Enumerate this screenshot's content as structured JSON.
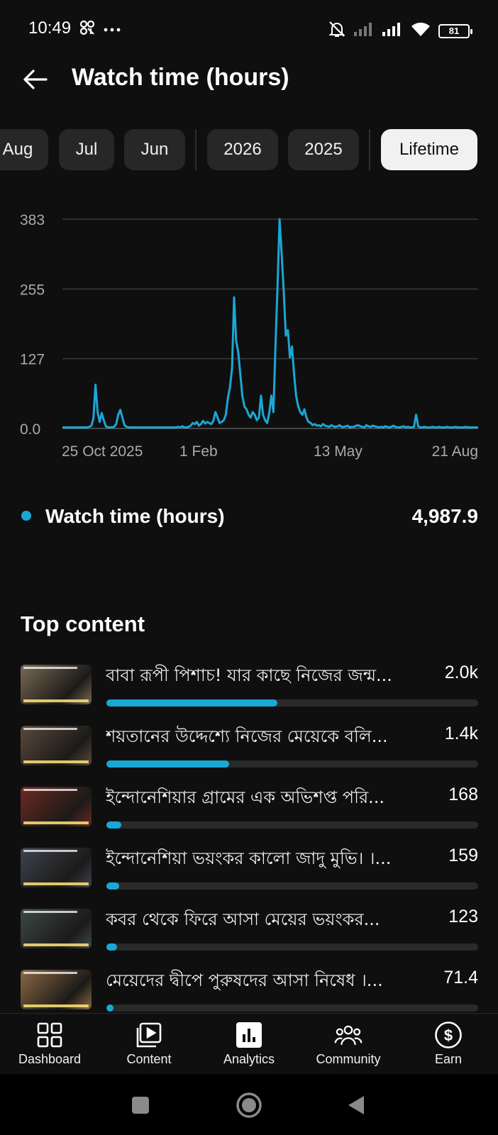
{
  "status_bar": {
    "time": "10:49",
    "battery": "81"
  },
  "header": {
    "title": "Watch time (hours)"
  },
  "period_chips": [
    {
      "label": "Aug",
      "selected": false
    },
    {
      "label": "Jul",
      "selected": false
    },
    {
      "label": "Jun",
      "selected": false
    },
    {
      "label": "2026",
      "selected": false
    },
    {
      "label": "2025",
      "selected": false
    },
    {
      "label": "Lifetime",
      "selected": true
    }
  ],
  "chart_data": {
    "type": "line",
    "y_ticks": [
      "383",
      "255",
      "127",
      "0.0"
    ],
    "x_ticks": [
      "25 Oct 2025",
      "1 Feb",
      "13 May",
      "21 Aug"
    ],
    "ylim": [
      0,
      383
    ],
    "grid": true,
    "line_color": "#1aa7d6",
    "series": [
      {
        "values": [
          2,
          2,
          2,
          2,
          2,
          2,
          2,
          2,
          2,
          2,
          2,
          2,
          2,
          3,
          5,
          18,
          80,
          30,
          12,
          28,
          15,
          4,
          2,
          2,
          2,
          3,
          8,
          25,
          34,
          20,
          6,
          3,
          2,
          2,
          2,
          2,
          2,
          2,
          2,
          2,
          2,
          2,
          2,
          2,
          2,
          2,
          2,
          2,
          2,
          2,
          2,
          2,
          2,
          2,
          2,
          2,
          3,
          2,
          4,
          2,
          2,
          3,
          5,
          10,
          8,
          12,
          5,
          8,
          14,
          9,
          12,
          10,
          8,
          14,
          30,
          20,
          10,
          12,
          15,
          25,
          55,
          75,
          110,
          240,
          160,
          140,
          100,
          60,
          40,
          35,
          25,
          20,
          30,
          25,
          15,
          20,
          60,
          25,
          15,
          10,
          28,
          60,
          30,
          150,
          260,
          383,
          320,
          250,
          170,
          180,
          130,
          150,
          100,
          60,
          40,
          30,
          25,
          35,
          20,
          12,
          10,
          6,
          8,
          5,
          6,
          4,
          8,
          5,
          4,
          3,
          6,
          4,
          3,
          4,
          6,
          3,
          3,
          4,
          5,
          2,
          3,
          3,
          5,
          6,
          4,
          3,
          2,
          6,
          4,
          3,
          5,
          4,
          3,
          2,
          3,
          2,
          4,
          3,
          2,
          3,
          5,
          3,
          2,
          2,
          3,
          4,
          2,
          3,
          2,
          2,
          3,
          25,
          4,
          2,
          2,
          3,
          2,
          2,
          2,
          3,
          2,
          2,
          3,
          2,
          2,
          2,
          3,
          2,
          2,
          2,
          3,
          2,
          2,
          2,
          2,
          3,
          2,
          2,
          2,
          2,
          2,
          2
        ]
      }
    ]
  },
  "legend": {
    "label": "Watch time (hours)",
    "value": "4,987.9"
  },
  "top_content": {
    "title": "Top content",
    "items": [
      {
        "title": "বাবা রূপী পিশাচ! যার কাছে নিজের জন্ম...",
        "value": "2.0k",
        "fraction": 0.46,
        "thumb": "#7a6a55"
      },
      {
        "title": "শয়তানের উদ্দেশ্যে নিজের মেয়েকে বলি...",
        "value": "1.4k",
        "fraction": 0.33,
        "thumb": "#5a4a3c"
      },
      {
        "title": "ইন্দোনেশিয়ার গ্রামের এক অভিশপ্ত পরি...",
        "value": "168",
        "fraction": 0.04,
        "thumb": "#6b2a22"
      },
      {
        "title": "ইন্দোনেশিয়া ভয়ংকর কালো জাদু মুভি। ।...",
        "value": "159",
        "fraction": 0.035,
        "thumb": "#3e4450"
      },
      {
        "title": "কবর থেকে ফিরে আসা মেয়ের ভয়ংকর...",
        "value": "123",
        "fraction": 0.028,
        "thumb": "#3b4a48"
      },
      {
        "title": "মেয়েদের দ্বীপে পুরুষদের আসা নিষেধ ।...",
        "value": "71.4",
        "fraction": 0.02,
        "thumb": "#8a6a45"
      }
    ]
  },
  "bottom_nav": [
    {
      "label": "Dashboard",
      "icon": "dashboard-icon",
      "active": false
    },
    {
      "label": "Content",
      "icon": "content-icon",
      "active": false
    },
    {
      "label": "Analytics",
      "icon": "analytics-icon",
      "active": true
    },
    {
      "label": "Community",
      "icon": "community-icon",
      "active": false
    },
    {
      "label": "Earn",
      "icon": "earn-icon",
      "active": false
    }
  ],
  "colors": {
    "accent": "#1aa7d6",
    "background": "#0f0f0f",
    "chip": "#272727",
    "chip_selected": "#f1f1f1"
  }
}
